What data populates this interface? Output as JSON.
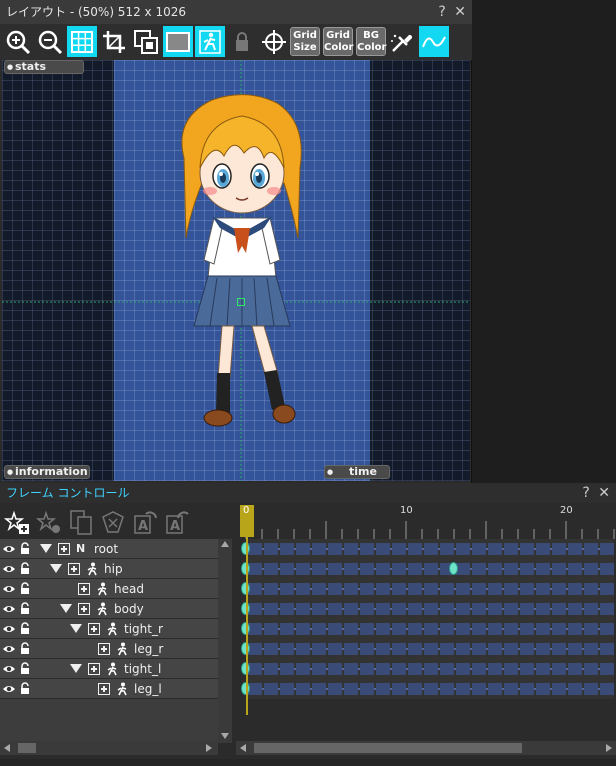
{
  "layout": {
    "title": "レイアウト - (50%)  512 x 1026",
    "help": "?",
    "close": "✕",
    "toolbar": {
      "zoom_in_icon": "zoom-in-icon",
      "zoom_out_icon": "zoom-out-icon",
      "grid_toggle_icon": "grid-icon",
      "grid_size_label": [
        "Grid",
        "Size"
      ],
      "grid_color_label": [
        "Grid",
        "Color"
      ],
      "bg_color_label": [
        "BG",
        "Color"
      ]
    },
    "tabs": {
      "stats": "stats",
      "information": "information",
      "time": "time"
    },
    "colors": {
      "toolbar_active": "#12d8f2",
      "stage_bg": "#34549a",
      "canvas_bg": "#131a2a"
    }
  },
  "frame_control": {
    "title": "フレーム コントロール",
    "help": "?",
    "close": "✕",
    "tree": [
      {
        "name": "root",
        "kind": "N",
        "expanded": true,
        "indent": 0
      },
      {
        "name": "hip",
        "kind": "bone",
        "expanded": true,
        "indent": 1
      },
      {
        "name": "head",
        "kind": "bone",
        "expanded": false,
        "indent": 2
      },
      {
        "name": "body",
        "kind": "bone",
        "expanded": true,
        "indent": 2
      },
      {
        "name": "tight_r",
        "kind": "bone",
        "expanded": true,
        "indent": 3
      },
      {
        "name": "leg_r",
        "kind": "bone",
        "expanded": false,
        "indent": 4
      },
      {
        "name": "tight_l",
        "kind": "bone",
        "expanded": true,
        "indent": 3
      },
      {
        "name": "leg_l",
        "kind": "bone",
        "expanded": false,
        "indent": 4
      }
    ],
    "ruler": {
      "current_frame": "0",
      "labels": [
        "10",
        "20"
      ]
    },
    "keyframes": [
      {
        "row": 0,
        "frame": 0
      },
      {
        "row": 1,
        "frame": 0
      },
      {
        "row": 1,
        "frame": 13
      },
      {
        "row": 2,
        "frame": 0
      },
      {
        "row": 3,
        "frame": 0
      },
      {
        "row": 4,
        "frame": 0
      },
      {
        "row": 5,
        "frame": 0
      },
      {
        "row": 6,
        "frame": 0
      },
      {
        "row": 7,
        "frame": 0
      }
    ],
    "colors": {
      "title_color": "#3fd4ff",
      "keyframe": "#6fe3c8",
      "playhead": "#b8a51a"
    }
  }
}
